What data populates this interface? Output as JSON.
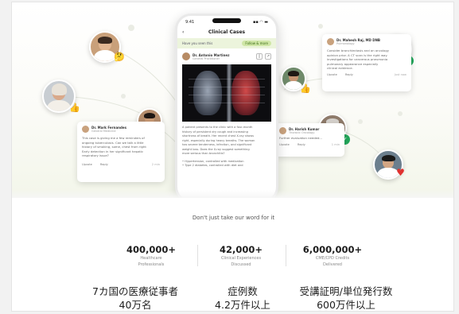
{
  "phone": {
    "time": "9:41",
    "signal": "▪▪ ◠ ▬",
    "back_icon": "chevron-left-icon",
    "title": "Clinical Cases",
    "banner_text": "Have you seen this",
    "banner_pill": "Follow & more",
    "author_name": "Dr. Antonio Martinez",
    "author_role": "General Practitioner",
    "body_lines": [
      "A patient presents to the clinic with a four-month",
      "history of persistent dry cough and increasing",
      "shortness of breath. Her recent chest X-ray shows",
      "right, especially during heavy breaths. The woman",
      "has severe tenderness, infection, and significant",
      "weight loss. Does the X-ray suggest something",
      "more serious than bronchitis?"
    ],
    "bullets": [
      "• Hypertension, controlled with medication",
      "• Type 2 diabetes, controlled with diet and"
    ]
  },
  "cards": {
    "left": {
      "name": "Dr. Mark Fernandes",
      "role": "General Medicine",
      "lines": [
        "This case is giving me a few reminders of",
        "ongoing tuberculosis. Can we talk a little",
        "history of smoking, some, chest from right",
        "Early detection in her significant hepatic",
        "respiratory issue?"
      ],
      "actions": [
        "Upvote",
        "Reply"
      ],
      "time": "2 min"
    },
    "right_top": {
      "name": "Dr. Mahesh Raj, MD DNB",
      "role": "Pulmonology",
      "lines": [
        "Consider bronchiectasis and an oncology",
        "opinion prior. A CT scan is the right way.",
        "investigations for cancerous pneumonia",
        "pulmonary appearance especially",
        "clinical evidence."
      ],
      "actions": [
        "Upvote",
        "Reply"
      ],
      "time": "Just now"
    },
    "right_mid": {
      "name": "Dr. Harish Kumar",
      "role": "Thoracic Oncology",
      "lines": [
        "Further evaluation needed..."
      ],
      "actions": [
        "Upvote",
        "Reply"
      ],
      "time": "1 min"
    }
  },
  "badges": {
    "check": "✓",
    "emoji": "🤔",
    "thumbs": "👍",
    "heart": "♥"
  },
  "stats": {
    "tagline": "Don't just take our word for it",
    "items": [
      {
        "num": "400,000+",
        "label1": "Healthcare",
        "label2": "Professionals"
      },
      {
        "num": "42,000+",
        "label1": "Clinical Experiences",
        "label2": "Discussed"
      },
      {
        "num": "6,000,000+",
        "label1": "CME/CPD Credits",
        "label2": "Delivered"
      }
    ]
  },
  "japanese": [
    {
      "line1": "7カ国の医療従事者",
      "line2": "40万名"
    },
    {
      "line1": "症例数",
      "line2": "4.2万件以上"
    },
    {
      "line1": "受講証明/単位発行数",
      "line2": "600万件以上"
    }
  ],
  "colors": {
    "accent_green": "#22a65a",
    "banner_green": "#ecf4dc",
    "heart_red": "#e0312f"
  }
}
